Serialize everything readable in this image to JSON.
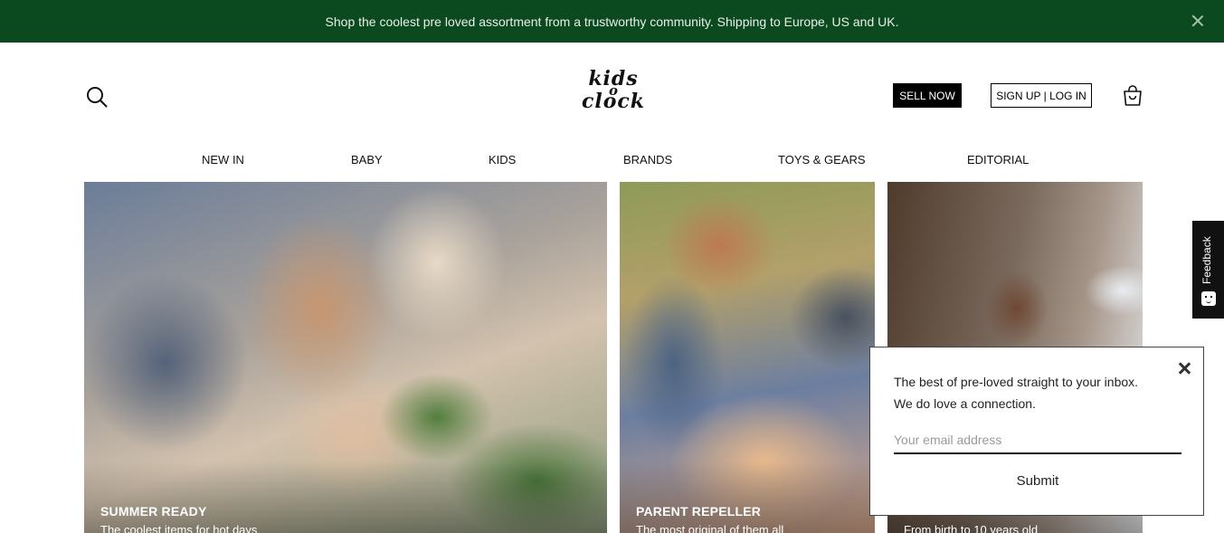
{
  "announcement": {
    "text": "Shop the coolest pre loved assortment from a trustworthy community. Shipping to Europe, US and UK."
  },
  "header": {
    "logo_line1": "kids",
    "logo_line2": "o",
    "logo_line3": "clock",
    "sell_label": "SELL NOW",
    "login_label": "SIGN UP | LOG IN"
  },
  "nav": {
    "items": [
      {
        "label": "NEW IN"
      },
      {
        "label": "BABY"
      },
      {
        "label": "KIDS"
      },
      {
        "label": "BRANDS"
      },
      {
        "label": "TOYS & GEARS"
      },
      {
        "label": "EDITORIAL"
      }
    ]
  },
  "tiles": [
    {
      "title": "SUMMER READY",
      "subtitle": "The coolest items for hot days"
    },
    {
      "title": "PARENT REPELLER",
      "subtitle": "The most original of them all"
    },
    {
      "title": "",
      "subtitle": "From birth to 10 years old"
    }
  ],
  "feedback": {
    "label": "Feedback"
  },
  "newsletter": {
    "line1": "The best of pre-loved straight to your inbox.",
    "line2": "We do love a connection.",
    "placeholder": "Your email address",
    "submit_label": "Submit"
  },
  "colors": {
    "announcement_bg": "#0b4a1e",
    "primary_button": "#000000"
  }
}
